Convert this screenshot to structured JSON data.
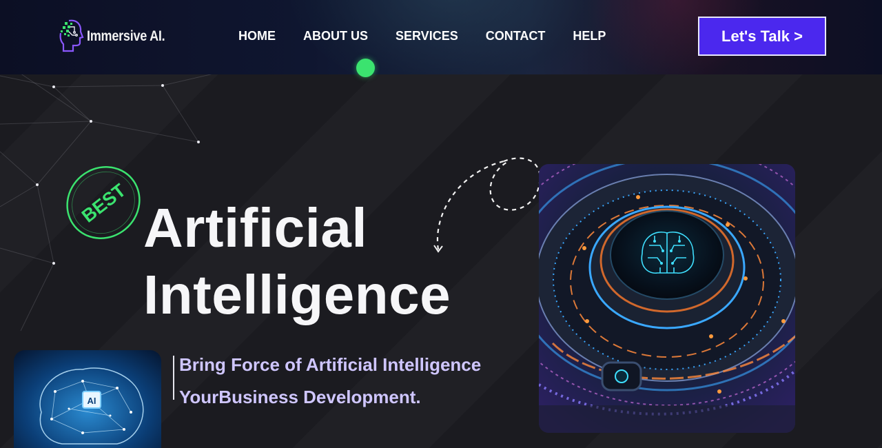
{
  "brand": {
    "name": "Immersive AI.",
    "logo_icon": "head-circuit-icon"
  },
  "nav": {
    "items": [
      "HOME",
      "ABOUT US",
      "SERVICES",
      "CONTACT",
      "HELP"
    ]
  },
  "cta": {
    "label": "Let's Talk >"
  },
  "hero": {
    "badge": "BEST",
    "title_line1": "Artificial",
    "title_line2": "Intelligence",
    "tagline_line1": "Bring Force of Artificial Intelligence",
    "tagline_line2": "YourBusiness Development.",
    "small_image_label": "AI"
  },
  "colors": {
    "accent": "#4b28ee",
    "highlight_green": "#3be36f",
    "tagline": "#cfc6ff",
    "background": "#1b1b20"
  }
}
